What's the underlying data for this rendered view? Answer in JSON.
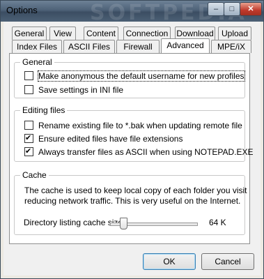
{
  "window": {
    "title": "Options",
    "watermark": "SOFTPEDIA",
    "controls": {
      "minimize": "–",
      "maximize": "□",
      "close": "✕"
    }
  },
  "tabs_row1": [
    "General",
    "View",
    "Content",
    "Connection",
    "Download",
    "Upload"
  ],
  "tabs_row2": [
    "Index Files",
    "ASCII Files",
    "Firewall",
    "Advanced",
    "MPE/iX"
  ],
  "active_tab": "Advanced",
  "general": {
    "title": "General",
    "options": [
      {
        "label": "Make anonymous the default username for new profiles",
        "checked": false
      },
      {
        "label": "Save settings in INI file",
        "checked": false
      }
    ]
  },
  "editing": {
    "title": "Editing files",
    "options": [
      {
        "label": "Rename existing file to *.bak when updating remote file",
        "checked": false
      },
      {
        "label": "Ensure edited files have file extensions",
        "checked": true
      },
      {
        "label": "Always transfer files as ASCII when using NOTEPAD.EXE",
        "checked": true
      }
    ]
  },
  "cache": {
    "title": "Cache",
    "description_line1": "The cache is used to keep local copy of each folder you visit",
    "description_line2": "reducing network traffic. This is very useful on the Internet.",
    "slider_label": "Directory listing cache size:",
    "slider_value": "64 K",
    "slider_fraction": 0.15
  },
  "buttons": {
    "ok": "OK",
    "cancel": "Cancel"
  }
}
